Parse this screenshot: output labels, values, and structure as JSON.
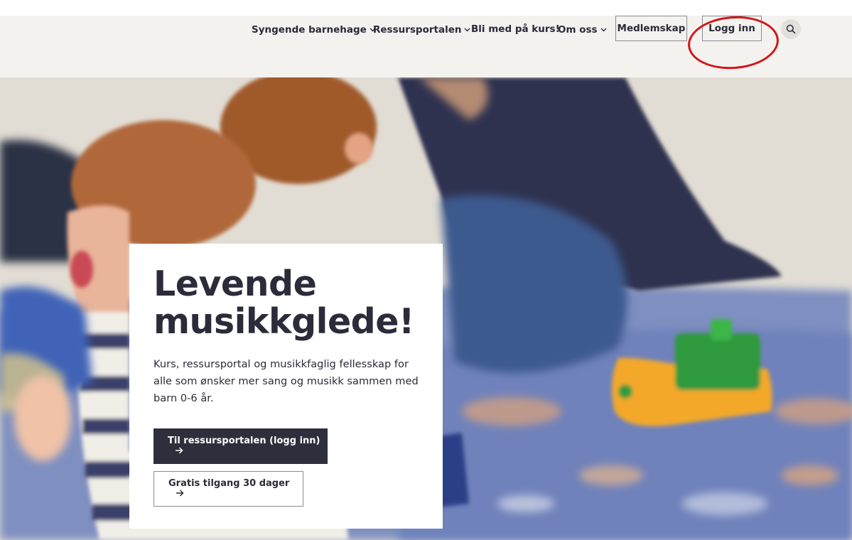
{
  "nav": {
    "items": [
      {
        "label": "Syngende barnehage",
        "has_dropdown": true,
        "icon": "chevron-down-icon"
      },
      {
        "label": "Ressursportalen",
        "has_dropdown": true,
        "icon": "chevron-down-icon"
      },
      {
        "label": "Bli med på kurs!",
        "has_dropdown": false
      },
      {
        "label": "Om oss",
        "has_dropdown": true,
        "icon": "chevron-down-icon"
      }
    ],
    "membership_label": "Medlemskap",
    "login_label": "Logg inn",
    "search_icon": "search-icon"
  },
  "hero": {
    "title_line1": "Levende",
    "title_line2": "musikkglede!",
    "description": "Kurs, ressursportal og musikkfaglig fellesskap for alle som ønsker mer sang og musikk sammen med barn 0-6 år.",
    "primary_button": "Til ressursportalen (logg inn)",
    "secondary_button": "Gratis tilgang 30 dager",
    "arrow_icon": "arrow-right-icon"
  },
  "colors": {
    "header_bg": "#f3f2ee",
    "primary_button_bg": "#2e2e3d",
    "text": "#2b2b3a",
    "annotation": "#d4141c"
  }
}
